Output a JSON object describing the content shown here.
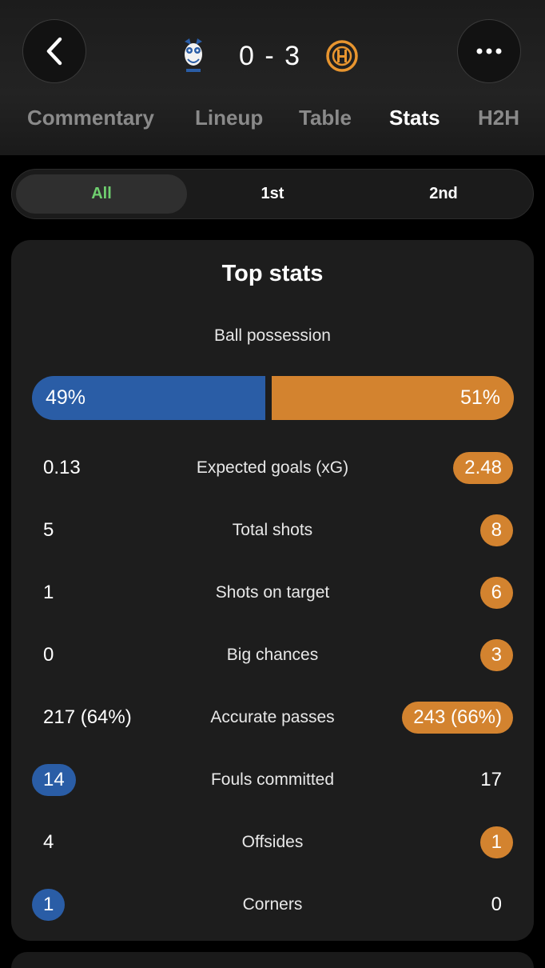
{
  "match": {
    "score": "0 - 3",
    "home_badge": "owl-crest-icon",
    "away_badge": "orange-crest-icon"
  },
  "tabs": [
    {
      "label": "Commentary"
    },
    {
      "label": "Lineup"
    },
    {
      "label": "Table"
    },
    {
      "label": "Stats",
      "active": true
    },
    {
      "label": "H2H"
    }
  ],
  "periods": [
    {
      "label": "All",
      "active": true
    },
    {
      "label": "1st"
    },
    {
      "label": "2nd"
    }
  ],
  "top_stats": {
    "title": "Top stats",
    "possession": {
      "label": "Ball possession",
      "home": "49%",
      "away": "51%",
      "home_value": 49,
      "away_value": 51
    },
    "rows": [
      {
        "label": "Expected goals (xG)",
        "home": "0.13",
        "away": "2.48",
        "highlight": "away"
      },
      {
        "label": "Total shots",
        "home": "5",
        "away": "8",
        "highlight": "away"
      },
      {
        "label": "Shots on target",
        "home": "1",
        "away": "6",
        "highlight": "away"
      },
      {
        "label": "Big chances",
        "home": "0",
        "away": "3",
        "highlight": "away"
      },
      {
        "label": "Accurate passes",
        "home": "217 (64%)",
        "away": "243 (66%)",
        "highlight": "away"
      },
      {
        "label": "Fouls committed",
        "home": "14",
        "away": "17",
        "highlight": "home"
      },
      {
        "label": "Offsides",
        "home": "4",
        "away": "1",
        "highlight": "away"
      },
      {
        "label": "Corners",
        "home": "1",
        "away": "0",
        "highlight": "home"
      }
    ]
  },
  "colors": {
    "home": "#2a5da6",
    "away": "#d3832f",
    "active_period": "#6fcf6f"
  }
}
